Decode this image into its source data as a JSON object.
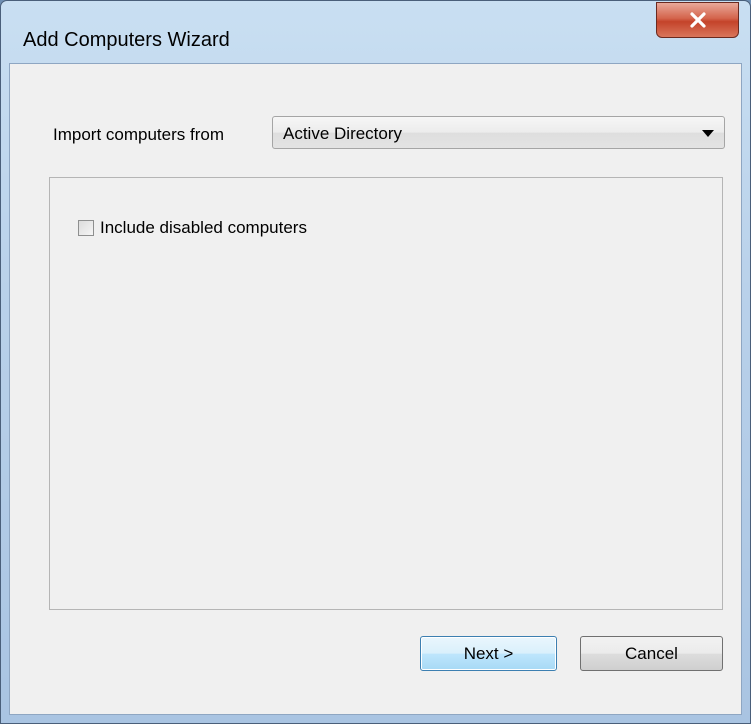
{
  "window": {
    "title": "Add Computers Wizard",
    "close_symbol": "x"
  },
  "import": {
    "label": "Import computers from",
    "selected": "Active Directory"
  },
  "options": {
    "include_disabled_label": "Include disabled computers",
    "include_disabled_checked": false
  },
  "buttons": {
    "next_label": "Next >",
    "cancel_label": "Cancel"
  },
  "colors": {
    "client_bg": "#f0f0f0",
    "close_btn": "#c4432a",
    "default_btn_border": "#3c7fb1"
  }
}
